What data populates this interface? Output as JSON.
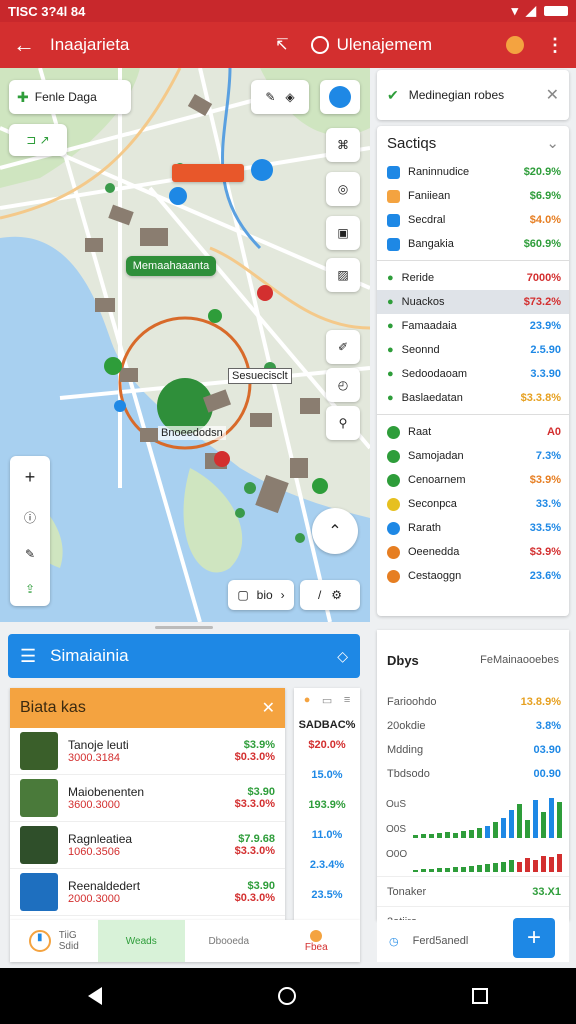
{
  "status": {
    "time": "TISC 3?4l 84"
  },
  "appbar": {
    "title": "Inaajarieta",
    "title2": "Ulenajemem"
  },
  "map": {
    "search_label": "Fenle Daga",
    "labels": [
      "Memaahaaanta",
      "Bnoeedodsn",
      "Sesuecisclt"
    ],
    "nav_label": "bio"
  },
  "right": {
    "header": "Medinegian robes",
    "section": "Sactiqs",
    "top_rows": [
      {
        "name": "Raninnudice",
        "value": "$20.9%",
        "color": "#2e9d3a"
      },
      {
        "name": "Faniiean",
        "value": "$6.9%",
        "color": "#2e9d3a"
      },
      {
        "name": "Secdral",
        "value": "$4.0%",
        "color": "#e67e22"
      },
      {
        "name": "Bangakia",
        "value": "$60.9%",
        "color": "#2e9d3a"
      }
    ],
    "mid_rows": [
      {
        "name": "Reride",
        "value": "7000%",
        "color": "#d32f2f"
      },
      {
        "name": "Nuackos",
        "value": "$73.2%",
        "color": "#d32f2f"
      },
      {
        "name": "Famaadaia",
        "value": "23.9%",
        "color": "#1e88e5"
      },
      {
        "name": "Seonnd",
        "value": "2.5.90",
        "color": "#1e88e5"
      },
      {
        "name": "Sedoodaoam",
        "value": "3.3.90",
        "color": "#1e88e5"
      },
      {
        "name": "Baslaedatan",
        "value": "$3.3.8%",
        "color": "#e6a020"
      }
    ],
    "list_rows": [
      {
        "name": "Raat",
        "value": "A0",
        "color": "#d32f2f",
        "dot": "#2e9d3a"
      },
      {
        "name": "Samojadan",
        "value": "7.3%",
        "color": "#1e88e5",
        "dot": "#2e9d3a"
      },
      {
        "name": "Cenoarnem",
        "value": "$3.9%",
        "color": "#e67e22",
        "dot": "#2e9d3a"
      },
      {
        "name": "Seconpca",
        "value": "33.%",
        "color": "#1e88e5",
        "dot": "#e6c020"
      },
      {
        "name": "Rarath",
        "value": "33.5%",
        "color": "#1e88e5",
        "dot": "#1e88e5"
      },
      {
        "name": "Oeenedda",
        "value": "$3.9%",
        "color": "#d32f2f",
        "dot": "#e67e22"
      },
      {
        "name": "Cestaoggn",
        "value": "23.6%",
        "color": "#1e88e5",
        "dot": "#e67e22"
      }
    ]
  },
  "bottom": {
    "bar_title": "Simaiainia",
    "panel_title": "Biata kas",
    "items": [
      {
        "name": "Tanoje leuti",
        "sub": "3000.3184",
        "v1": "$3.9%",
        "v2": "$0.3.0%",
        "thumb": "#3a5f2a"
      },
      {
        "name": "Maiobenenten",
        "sub": "3600.3000",
        "v1": "$3.90",
        "v2": "$3.3.0%",
        "thumb": "#4a7a3a"
      },
      {
        "name": "Ragnleatiea",
        "sub": "1060.3506",
        "v1": "$7.9.68",
        "v2": "$3.3.0%",
        "thumb": "#2f4f2a"
      },
      {
        "name": "Reenaldedert",
        "sub": "2000.3000",
        "v1": "$3.90",
        "v2": "$0.3.0%",
        "thumb": "#1e6fbf"
      }
    ],
    "mini_header": "SADBAC%",
    "mini_values": [
      {
        "v": "$20.0%",
        "color": "#d32f2f"
      },
      {
        "v": "15.0%",
        "color": "#1e88e5"
      },
      {
        "v": "193.9%",
        "color": "#2e9d3a"
      },
      {
        "v": "11.0%",
        "color": "#1e88e5"
      },
      {
        "v": "2.3.4%",
        "color": "#1e88e5"
      },
      {
        "v": "23.5%",
        "color": "#1e88e5"
      }
    ],
    "tabs": [
      "TiiG",
      "Weads",
      "Dbooeda",
      "Fbea"
    ],
    "tab0_sub": "Sdid"
  },
  "stats": {
    "title": "Dbys",
    "subtitle": "FeMainaooebes",
    "rows": [
      {
        "name": "Farioohdo",
        "value": "13.8.9%",
        "color": "#e6a020"
      },
      {
        "name": "20okdie",
        "value": "3.8%",
        "color": "#1e88e5"
      },
      {
        "name": "Mdding",
        "value": "03.90",
        "color": "#1e88e5"
      },
      {
        "name": "Tbdsodo",
        "value": "00.90",
        "color": "#1e88e5"
      }
    ],
    "chart_labels": [
      "OuS",
      "O0S",
      "O0O"
    ],
    "footer_rows": [
      {
        "name": "Tonaker",
        "value": "33.X1",
        "color": "#2e9d3a"
      },
      {
        "name": "3atiiro",
        "value": "",
        "color": "#222"
      }
    ],
    "bottom_label": "Ferd5anedl",
    "colors": {
      "green": "#2e9d3a",
      "blue": "#1e88e5",
      "red": "#d32f2f",
      "orange": "#f4a340"
    }
  }
}
